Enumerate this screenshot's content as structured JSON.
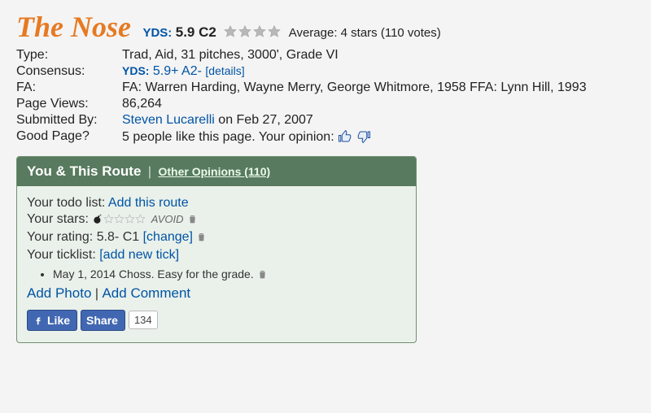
{
  "route": {
    "title": "The Nose",
    "yds_label": "YDS:",
    "grade": "5.9 C2",
    "average_label": "Average: 4 stars (110 votes)"
  },
  "meta": {
    "type_label": "Type:",
    "type_value": "Trad, Aid, 31 pitches, 3000', Grade VI",
    "consensus_label": "Consensus:",
    "consensus_yds": "YDS:",
    "consensus_value": "5.9+ A2-",
    "consensus_details": "[details]",
    "fa_label": "FA:",
    "fa_value": "FA: Warren Harding, Wayne Merry, George Whitmore, 1958 FFA: Lynn Hill, 1993",
    "pageviews_label": "Page Views:",
    "pageviews_value": "86,264",
    "submitted_label": "Submitted By:",
    "submitted_user": "Steven Lucarelli",
    "submitted_on": " on Feb 27, 2007",
    "good_label": "Good Page?",
    "good_text": "5 people like this page. Your opinion: "
  },
  "box": {
    "title": "You & This Route",
    "other_opinions": "Other Opinions (110)",
    "todo_label": "Your todo list: ",
    "todo_link": "Add this route",
    "stars_label": "Your stars: ",
    "avoid_text": "AVOID",
    "rating_label": "Your rating: ",
    "rating_value": "5.8- C1 ",
    "rating_change": "[change]",
    "ticklist_label": "Your ticklist: ",
    "ticklist_link": "[add new tick]",
    "tick_entry": "May 1, 2014 Choss. Easy for the grade. ",
    "add_photo": "Add Photo",
    "add_comment": "Add Comment",
    "fb_like": "Like",
    "fb_share": "Share",
    "fb_count": "134"
  }
}
